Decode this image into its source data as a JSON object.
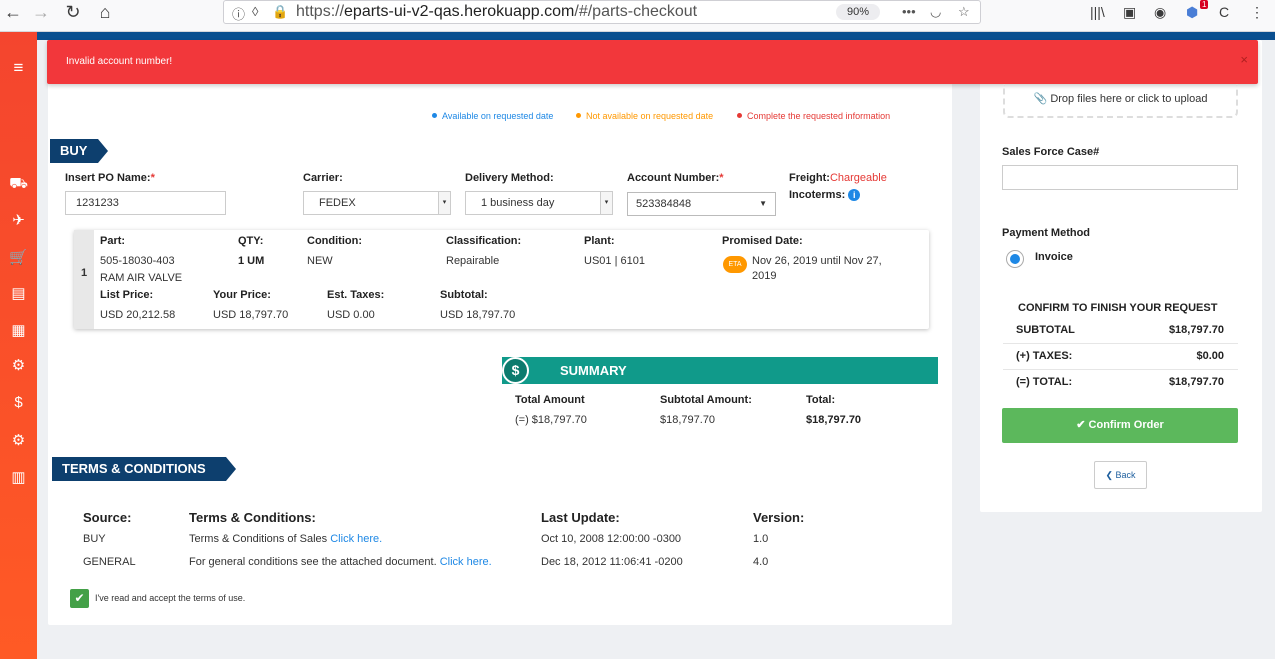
{
  "browser": {
    "url_prefix": "https://",
    "url_host": "eparts-ui-v2-qas.herokuapp.com",
    "url_path": "/#/parts-checkout",
    "zoom": "90%",
    "notification_count": "1"
  },
  "alert": {
    "message": "Invalid account number!",
    "close": "×"
  },
  "legend": {
    "available": "Available on requested date",
    "not_available": "Not available on requested date",
    "complete": "Complete the requested information",
    "colors": {
      "available": "#1e88e5",
      "not_available": "#ff9800",
      "complete": "#e53935"
    }
  },
  "buy": {
    "title": "BUY",
    "po_label": "Insert PO Name:",
    "po_value": "1231233",
    "carrier_label": "Carrier:",
    "carrier_value": "FEDEX",
    "delivery_label": "Delivery Method:",
    "delivery_value": "1 business day",
    "account_label": "Account Number:",
    "account_value": "523384848",
    "freight_label": "Freight:",
    "freight_value": "Chargeable",
    "incoterms_label": "Incoterms:",
    "required_mark": "*"
  },
  "part": {
    "index": "1",
    "labels": {
      "part": "Part:",
      "qty": "QTY:",
      "condition": "Condition:",
      "classification": "Classification:",
      "plant": "Plant:",
      "promised": "Promised Date:",
      "list_price": "List Price:",
      "your_price": "Your Price:",
      "taxes": "Est. Taxes:",
      "subtotal": "Subtotal:"
    },
    "number": "505-18030-403",
    "name": "RAM AIR VALVE",
    "qty": "1 UM",
    "condition": "NEW",
    "classification": "Repairable",
    "plant": "US01 | 6101",
    "eta_badge": "ETA",
    "promised_line1": "Nov 26, 2019 until Nov 27,",
    "promised_line2": "2019",
    "list_price": "USD 20,212.58",
    "your_price": "USD 18,797.70",
    "taxes": "USD 0.00",
    "subtotal": "USD 18,797.70"
  },
  "summary": {
    "title": "SUMMARY",
    "icon": "$",
    "total_amount_label": "Total Amount",
    "total_amount_value": "(=) $18,797.70",
    "subtotal_label": "Subtotal Amount:",
    "subtotal_value": "$18,797.70",
    "total_label": "Total:",
    "total_value": "$18,797.70"
  },
  "terms": {
    "title": "TERMS & CONDITIONS",
    "headers": {
      "source": "Source:",
      "terms": "Terms & Conditions:",
      "last_update": "Last Update:",
      "version": "Version:"
    },
    "rows": [
      {
        "source": "BUY",
        "text": "Terms & Conditions of Sales",
        "link": "Click here.",
        "last_update": "Oct 10, 2008 12:00:00 -0300",
        "version": "1.0"
      },
      {
        "source": "GENERAL",
        "text": "For general conditions see the attached document.",
        "link": "Click here.",
        "last_update": "Dec 18, 2012 11:06:41 -0200",
        "version": "4.0"
      }
    ],
    "accept_label": "I've read and accept the terms of use."
  },
  "side": {
    "dropzone": "Drop files here or click to upload",
    "sf_case_label": "Sales Force Case#",
    "sf_case_value": "",
    "payment_label": "Payment Method",
    "payment_option": "Invoice",
    "confirm_title": "CONFIRM TO FINISH YOUR REQUEST",
    "subtotal_label": "SUBTOTAL",
    "subtotal_value": "$18,797.70",
    "taxes_label": "(+) TAXES:",
    "taxes_value": "$0.00",
    "total_label": "(=) TOTAL:",
    "total_value": "$18,797.70",
    "confirm_button": "Confirm Order",
    "back_button": "Back"
  }
}
